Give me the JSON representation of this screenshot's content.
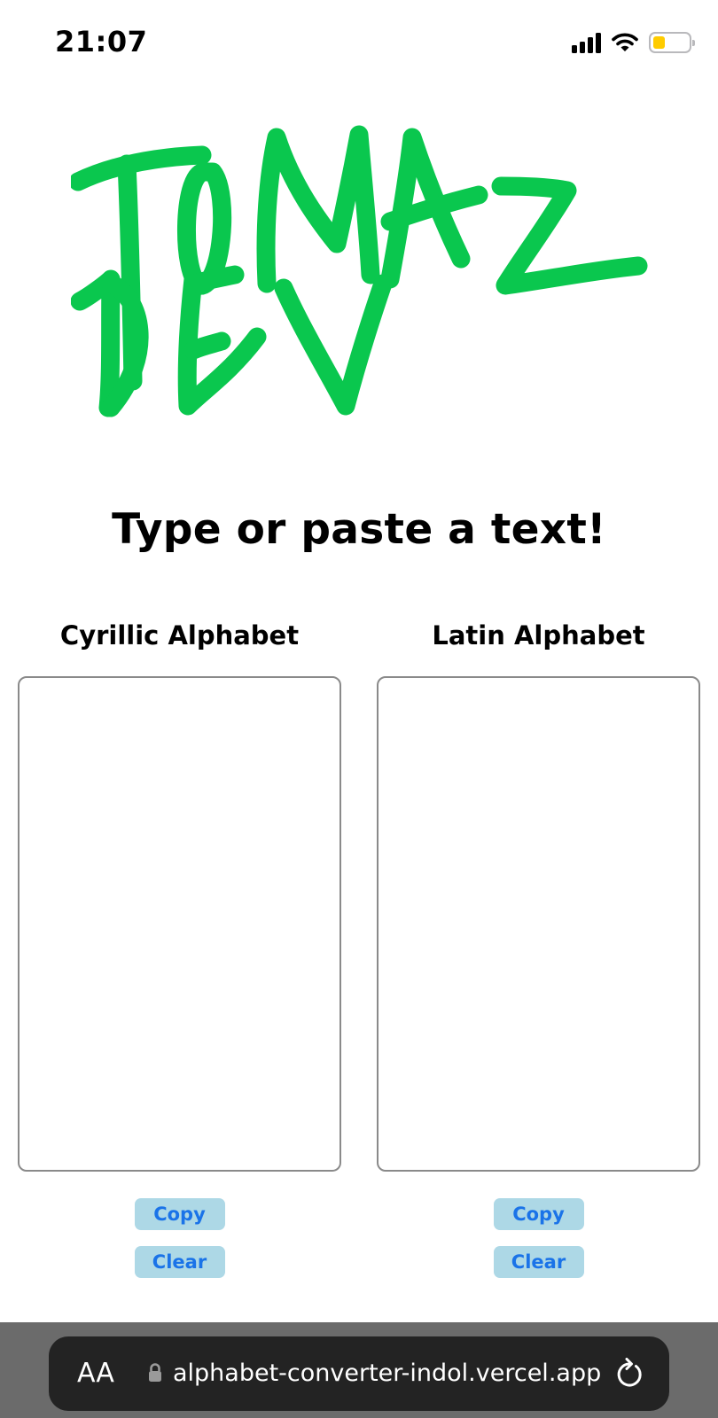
{
  "status_bar": {
    "time": "21:07",
    "icons": [
      "cellular-signal-icon",
      "wifi-icon",
      "battery-icon"
    ],
    "battery_color": "#ffcc00"
  },
  "logo": {
    "lines": [
      "TOMAZ",
      "DEV"
    ],
    "color": "#0ac74e"
  },
  "main": {
    "title": "Type or paste a text!",
    "columns": [
      {
        "label": "Cyrillic Alphabet",
        "value": "",
        "copy_label": "Copy",
        "clear_label": "Clear"
      },
      {
        "label": "Latin Alphabet",
        "value": "",
        "copy_label": "Copy",
        "clear_label": "Clear"
      }
    ]
  },
  "colors": {
    "button_bg": "#add8e6",
    "button_text": "#1a73e8",
    "border": "#8a8a8a"
  },
  "browser": {
    "text_size_label": "AA",
    "url": "alphabet-converter-indol.vercel.app",
    "icons": [
      "text-size-icon",
      "lock-icon",
      "reload-icon"
    ]
  }
}
